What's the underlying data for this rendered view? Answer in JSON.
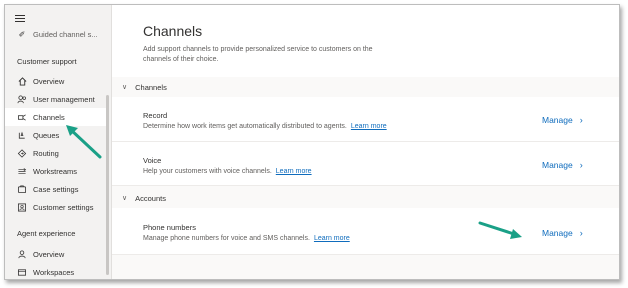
{
  "sidebar": {
    "top_item": "Guided channel s...",
    "customer_support_label": "Customer support",
    "items": [
      {
        "label": "Overview",
        "icon": "home-icon"
      },
      {
        "label": "User management",
        "icon": "people-icon"
      },
      {
        "label": "Channels",
        "icon": "channels-icon"
      },
      {
        "label": "Queues",
        "icon": "queues-icon"
      },
      {
        "label": "Routing",
        "icon": "routing-icon"
      },
      {
        "label": "Workstreams",
        "icon": "workstreams-icon"
      },
      {
        "label": "Case settings",
        "icon": "case-settings-icon"
      },
      {
        "label": "Customer settings",
        "icon": "customer-settings-icon"
      }
    ],
    "agent_experience_label": "Agent experience",
    "agent_items": [
      {
        "label": "Overview",
        "icon": "agent-overview-icon"
      },
      {
        "label": "Workspaces",
        "icon": "workspaces-icon"
      }
    ]
  },
  "main": {
    "title": "Channels",
    "description": "Add support channels to provide personalized service to customers on the channels of their choice.",
    "channels_group": "Channels",
    "accounts_group": "Accounts",
    "record": {
      "title": "Record",
      "desc": "Determine how work items get automatically distributed to agents.",
      "link": "Learn more",
      "action": "Manage"
    },
    "voice": {
      "title": "Voice",
      "desc": "Help your customers with voice channels.",
      "link": "Learn more",
      "action": "Manage"
    },
    "phone": {
      "title": "Phone numbers",
      "desc": "Manage phone numbers for voice and SMS channels.",
      "link": "Learn more",
      "action": "Manage"
    }
  },
  "colors": {
    "accent": "#0f6cbd",
    "annotation_arrow": "#1aa087"
  }
}
